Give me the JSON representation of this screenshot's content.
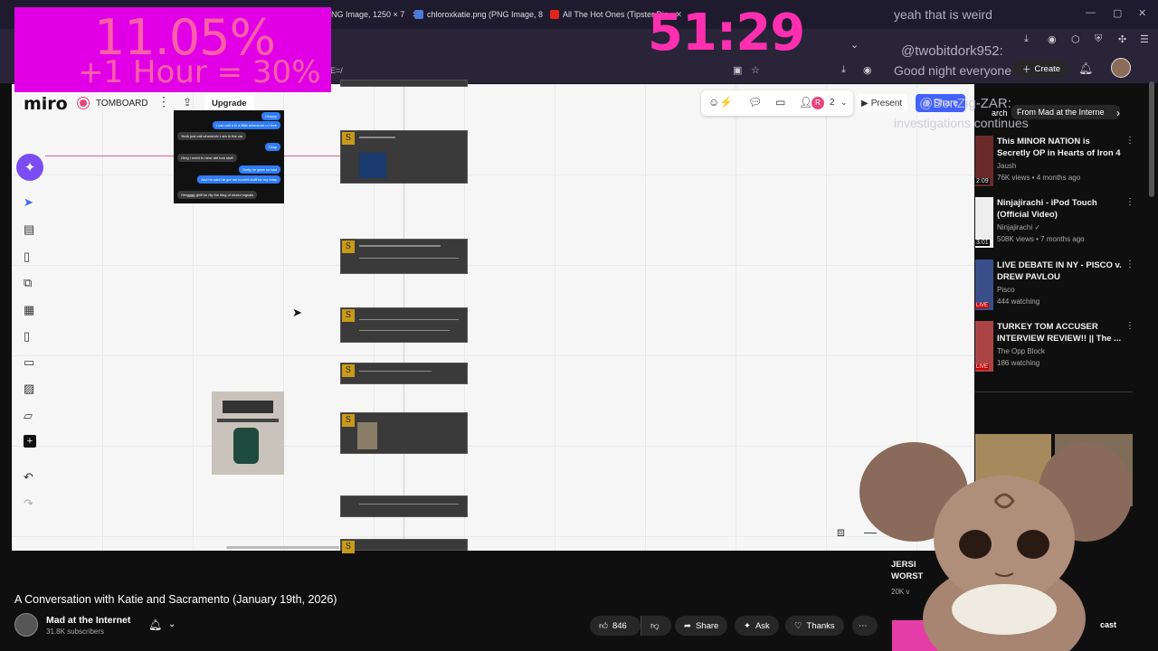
{
  "browser": {
    "tabs": [
      {
        "label": "PNG Image, 1250 × 7",
        "color": "#7a7a7a"
      },
      {
        "label": "chloroxkatie.png (PNG Image, 8",
        "color": "#4a7bd6"
      },
      {
        "label": "All The Hot Ones (Tipster Dis",
        "color": "#e2251c"
      }
    ],
    "url_fragment": "E=/"
  },
  "overlay": {
    "stat_line1": "11.05%",
    "stat_line2": "+1 Hour = 30%",
    "timer": "51:29"
  },
  "chat_overlay": [
    "yeah that is weird",
    "@twobitdork952:",
    "Good night everyone",
    "@BonZig-ZAR:",
    "investigations continues"
  ],
  "miro": {
    "logo": "miro",
    "board_name": "TOMBOARD",
    "upgrade": "Upgrade",
    "collaborator_initial": "R",
    "collaborator_count": "2",
    "present": "Present",
    "share": "Share",
    "card_letter": "S",
    "chat_bubbles": [
      {
        "text": "Okayyy",
        "side": "right"
      },
      {
        "text": "I can call u in a little whenever u r free",
        "side": "right"
      },
      {
        "text": "Yeah just call whenever I am in the car",
        "side": "left"
      },
      {
        "text": "Okay",
        "side": "right"
      },
      {
        "text": "Omg I need to hear abt tom stuff",
        "side": "left"
      },
      {
        "text": "Omfg he gave so bad",
        "side": "right"
      },
      {
        "text": "And he said he got me kuromi stuff for my bday",
        "side": "right"
      },
      {
        "text": "Omgggg girlll he rlly the king of mixed signals",
        "side": "left"
      }
    ]
  },
  "youtube": {
    "video_title": "A Conversation with Katie and Sacramento (January 19th, 2026)",
    "channel_name": "Mad at the Internet",
    "subscribers": "31.8K subscribers",
    "likes": "846",
    "share": "Share",
    "ask": "Ask",
    "thanks": "Thanks",
    "create": "Create",
    "chips": [
      "arch",
      "From Mad at the Interne"
    ],
    "recommendations": [
      {
        "title": "This MINOR NATION is Secretly OP in Hearts of Iron 4",
        "channel": "Jaush",
        "meta": "76K views • 4 months ago",
        "badge": "2:09"
      },
      {
        "title": "Ninjajirachi - iPod Touch (Official Video)",
        "channel": "Ninjajirachi",
        "meta": "508K views • 7 months ago",
        "badge": "3:01"
      },
      {
        "title": "LIVE DEBATE IN NY - PISCO v. DREW PAVLOU",
        "channel": "Pisco",
        "meta": "444 watching",
        "badge": "LIVE"
      },
      {
        "title": "TURKEY TOM ACCUSER INTERVIEW REVIEW!! || The ...",
        "channel": "The Opp Block",
        "meta": "186 watching",
        "badge": "LIVE"
      }
    ],
    "partial_rec": {
      "title1": "JERSI",
      "title2": "WORST",
      "meta": "20K v"
    },
    "partial_label": "cast"
  }
}
